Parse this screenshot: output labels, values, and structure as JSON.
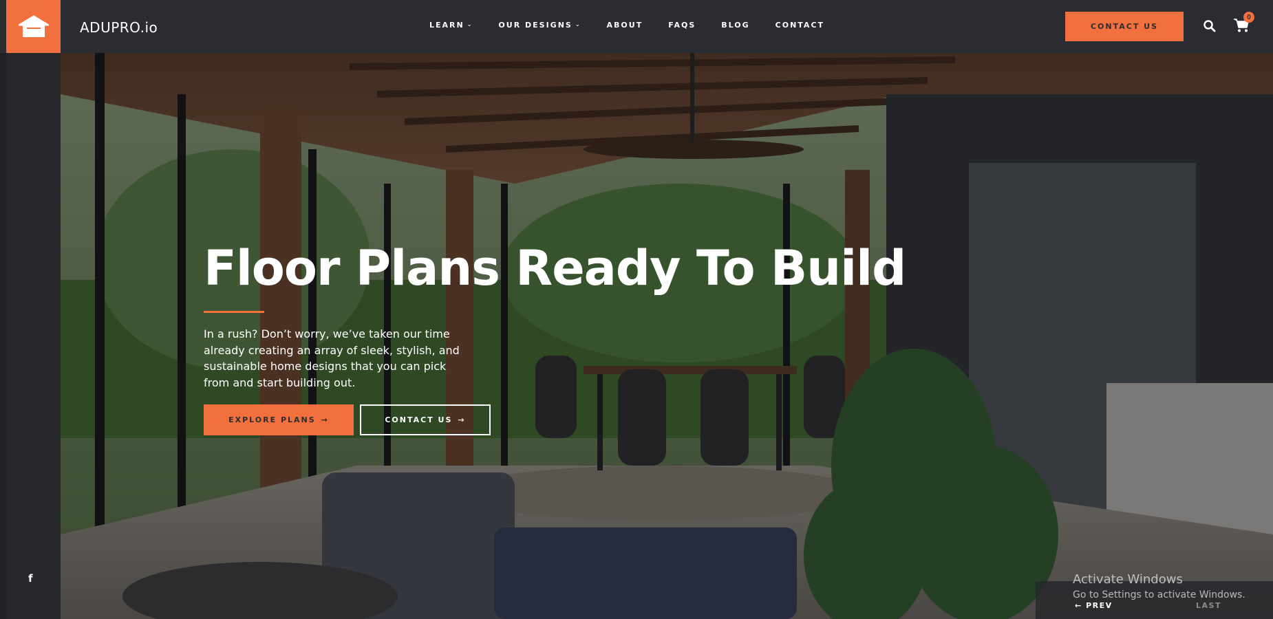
{
  "header": {
    "brand": "ADUPRO.io",
    "nav": [
      {
        "label": "LEARN",
        "dropdown": true
      },
      {
        "label": "OUR DESIGNS",
        "dropdown": true
      },
      {
        "label": "ABOUT",
        "dropdown": false
      },
      {
        "label": "FAQS",
        "dropdown": false
      },
      {
        "label": "BLOG",
        "dropdown": false
      },
      {
        "label": "CONTACT",
        "dropdown": false
      }
    ],
    "cta": "CONTACT US",
    "cart_count": "0",
    "icons": [
      "house-logo-icon",
      "search-icon",
      "cart-icon"
    ]
  },
  "hero": {
    "title": "Floor Plans Ready To Build",
    "text": "In a rush? Don’t worry, we’ve taken our time already creating an array of sleek, stylish, and sustainable home designs that you can pick from and start building out.",
    "primary_button": "EXPLORE PLANS",
    "secondary_button": "CONTACT US"
  },
  "sidebar": {
    "social_icon": "facebook-icon"
  },
  "slider": {
    "prev": "PREV",
    "last": "LAST"
  },
  "watermark": {
    "title": "Activate Windows",
    "subtitle": "Go to Settings to activate Windows."
  },
  "colors": {
    "accent": "#f2703d",
    "header_bg": "#2a2c31",
    "rail_bg": "#26282c"
  }
}
